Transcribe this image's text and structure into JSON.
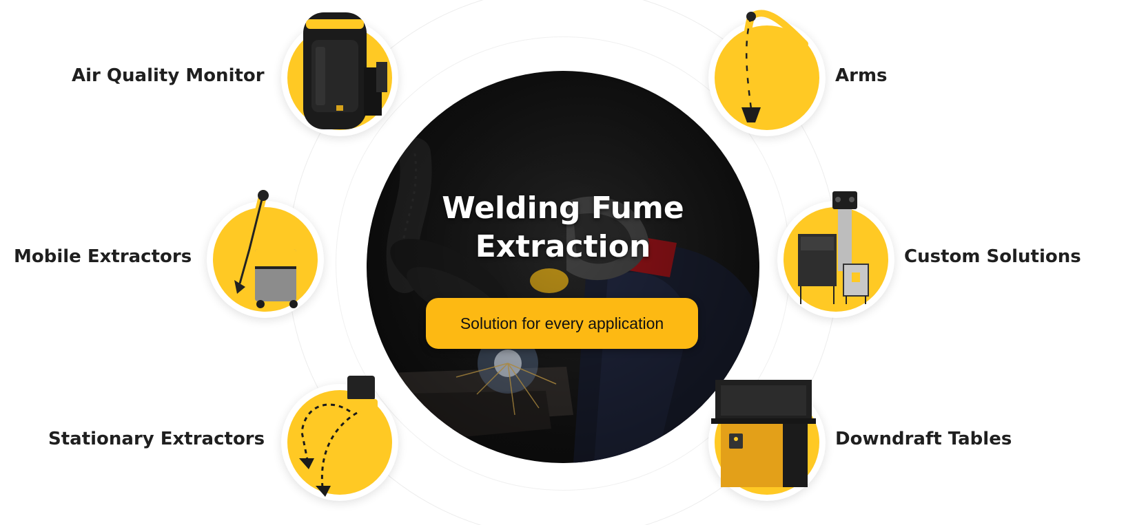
{
  "hero": {
    "title_line1": "Welding Fume",
    "title_line2": "Extraction",
    "cta_label": "Solution for every application"
  },
  "products": {
    "air_quality_monitor": "Air Quality Monitor",
    "mobile_extractors": "Mobile Extractors",
    "stationary_extractors": "Stationary Extractors",
    "arms": "Arms",
    "custom_solutions": "Custom Solutions",
    "downdraft_tables": "Downdraft Tables"
  },
  "colors": {
    "accent_yellow": "#ffc924",
    "cta_yellow": "#fdb913",
    "label_text": "#1f1f1f",
    "hero_bg": "#161616"
  },
  "icons": {
    "air_quality_monitor": "air-quality-monitor-icon",
    "mobile_extractors": "mobile-extractor-icon",
    "stationary_extractors": "stationary-extractor-icon",
    "arms": "extraction-arm-icon",
    "custom_solutions": "custom-solution-icon",
    "downdraft_tables": "downdraft-table-icon"
  }
}
